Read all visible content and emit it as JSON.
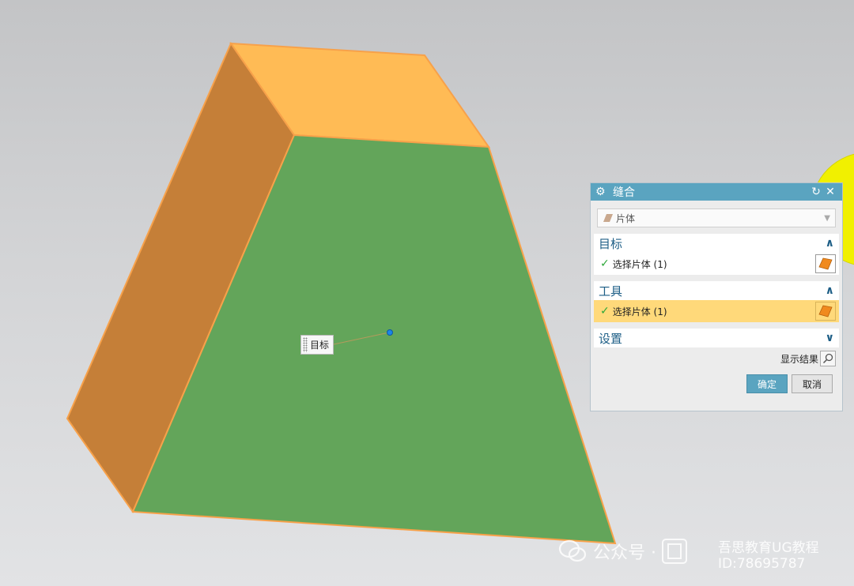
{
  "viewport": {
    "callout_label": "目标",
    "icons": [
      "yellow-sphere",
      "grip-icon",
      "target-point"
    ]
  },
  "dialog": {
    "title": "缝合",
    "title_icon": "gear-icon",
    "reset_icon": "reset-icon",
    "close_icon": "close-icon",
    "type_select": {
      "value": "片体",
      "icon": "sheet-icon"
    },
    "target": {
      "header": "目标",
      "row_label": "选择片体 (1)"
    },
    "tool": {
      "header": "工具",
      "row_label": "选择片体 (1)"
    },
    "settings": {
      "header": "设置"
    },
    "show_result": "显示结果",
    "ok": "确定",
    "cancel": "取消"
  },
  "watermark": {
    "left": "公众号 · ",
    "right_line1": "吾思教育UG教程",
    "right_line2": "ID:78695787"
  },
  "colors": {
    "front_face": "#63a55a",
    "top_face": "#ffbb55",
    "side_face": "#c57f38",
    "edge": "#f7a14a",
    "title_bar": "#5aa4c0",
    "highlight_row": "#ffd97a"
  }
}
